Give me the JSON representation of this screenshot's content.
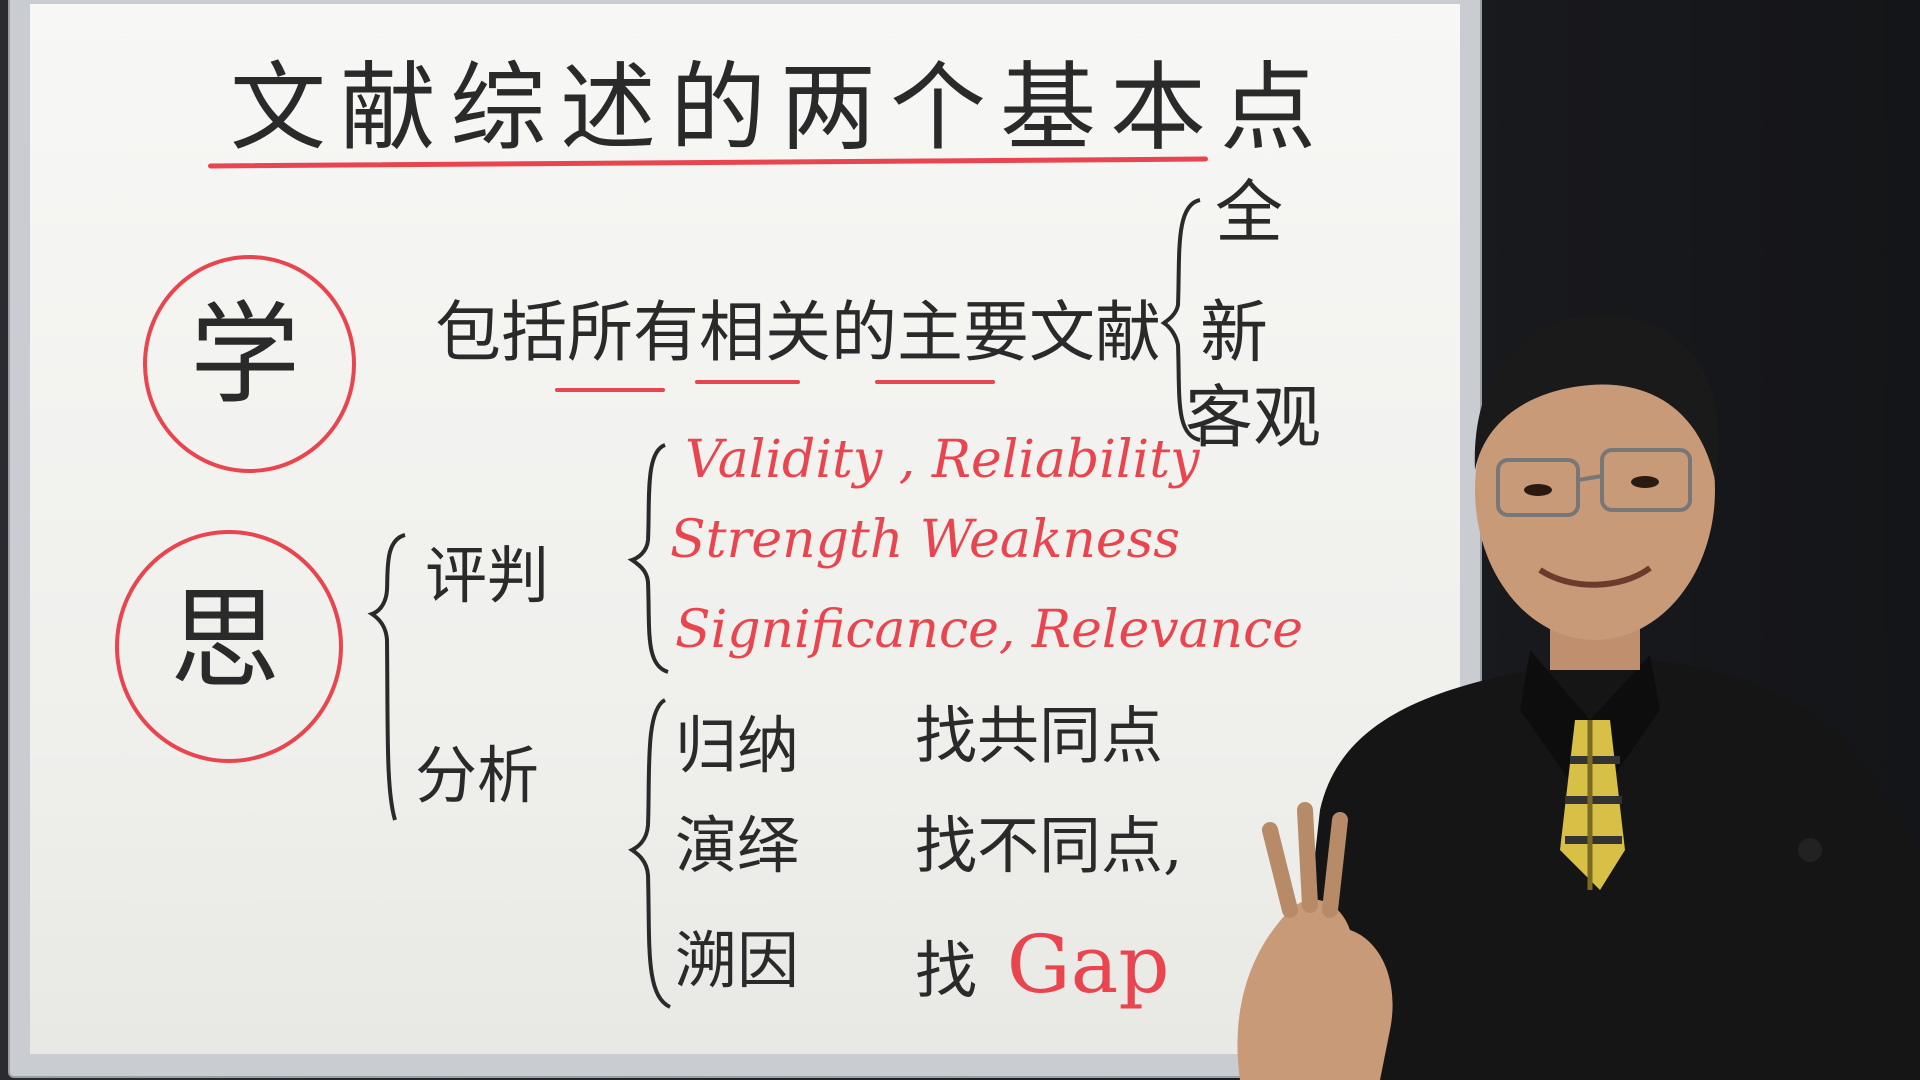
{
  "board": {
    "title": "文献综述的两个基本点",
    "xue": "学",
    "si": "思",
    "line1": {
      "p1": "包括",
      "p2": "所有",
      "p3": "相关",
      "p4": "的",
      "p5": "主要",
      "p6": "文献"
    },
    "right_chars": [
      "全",
      "新",
      "客观"
    ],
    "pingpan": "评判",
    "criteria": [
      "Validity , Reliability",
      "Strength  Weakness",
      "Significance, Relevance"
    ],
    "fenxi": "分析",
    "methods": [
      "归纳",
      "演绎",
      "溯因"
    ],
    "finds": {
      "f1": "找共同点",
      "f2": "找不同点,",
      "f3_prefix": "找",
      "f3_gap": "Gap"
    }
  },
  "colors": {
    "red_marker": "#e8454f",
    "black_marker": "#2a2a2a",
    "board": "#f4f4f1"
  }
}
